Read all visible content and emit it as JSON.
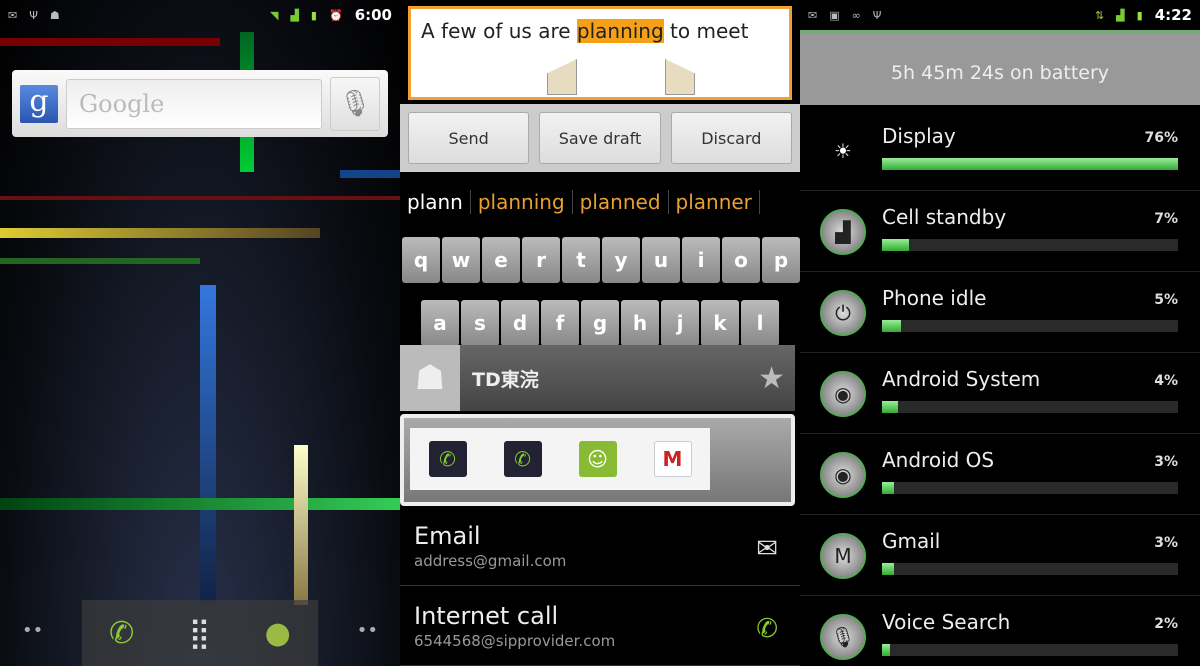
{
  "home": {
    "status": {
      "time": "6:00",
      "left_icons": [
        "mail-icon",
        "usb-icon",
        "android-icon"
      ],
      "right_icons": [
        "wifi-icon",
        "signal-icon",
        "battery-icon",
        "alarm-icon"
      ]
    },
    "search_placeholder": "Google",
    "dock": [
      "phone-icon",
      "apps-grid-icon",
      "browser-icon"
    ]
  },
  "compose": {
    "text_before": "A few of us are ",
    "text_selected": "planning",
    "text_after": " to meet",
    "buttons": [
      "Send",
      "Save draft",
      "Discard"
    ],
    "suggestions": [
      "plann",
      "planning",
      "planned",
      "planner"
    ],
    "keys_row1": [
      "q",
      "w",
      "e",
      "r",
      "t",
      "y",
      "u",
      "i",
      "o",
      "p"
    ],
    "keys_row2": [
      "a",
      "s",
      "d",
      "f",
      "g",
      "h",
      "j",
      "k",
      "l"
    ],
    "contact": {
      "name": "TD東浣",
      "actions": [
        "call",
        "sip-call",
        "message",
        "gmail"
      ],
      "rows": [
        {
          "title": "Email",
          "sub": "address@gmail.com"
        },
        {
          "title": "Internet call",
          "sub": "6544568@sipprovider.com"
        }
      ]
    }
  },
  "battery": {
    "status": {
      "time": "4:22"
    },
    "summary": "5h 45m 24s on battery",
    "items": [
      {
        "name": "Display",
        "pct": "76%",
        "value": 76
      },
      {
        "name": "Cell standby",
        "pct": "7%",
        "value": 7
      },
      {
        "name": "Phone idle",
        "pct": "5%",
        "value": 5
      },
      {
        "name": "Android System",
        "pct": "4%",
        "value": 4
      },
      {
        "name": "Android OS",
        "pct": "3%",
        "value": 3
      },
      {
        "name": "Gmail",
        "pct": "3%",
        "value": 3
      },
      {
        "name": "Voice Search",
        "pct": "2%",
        "value": 2
      }
    ]
  },
  "colors": {
    "accent_orange": "#f6a018",
    "green": "#3a3"
  }
}
